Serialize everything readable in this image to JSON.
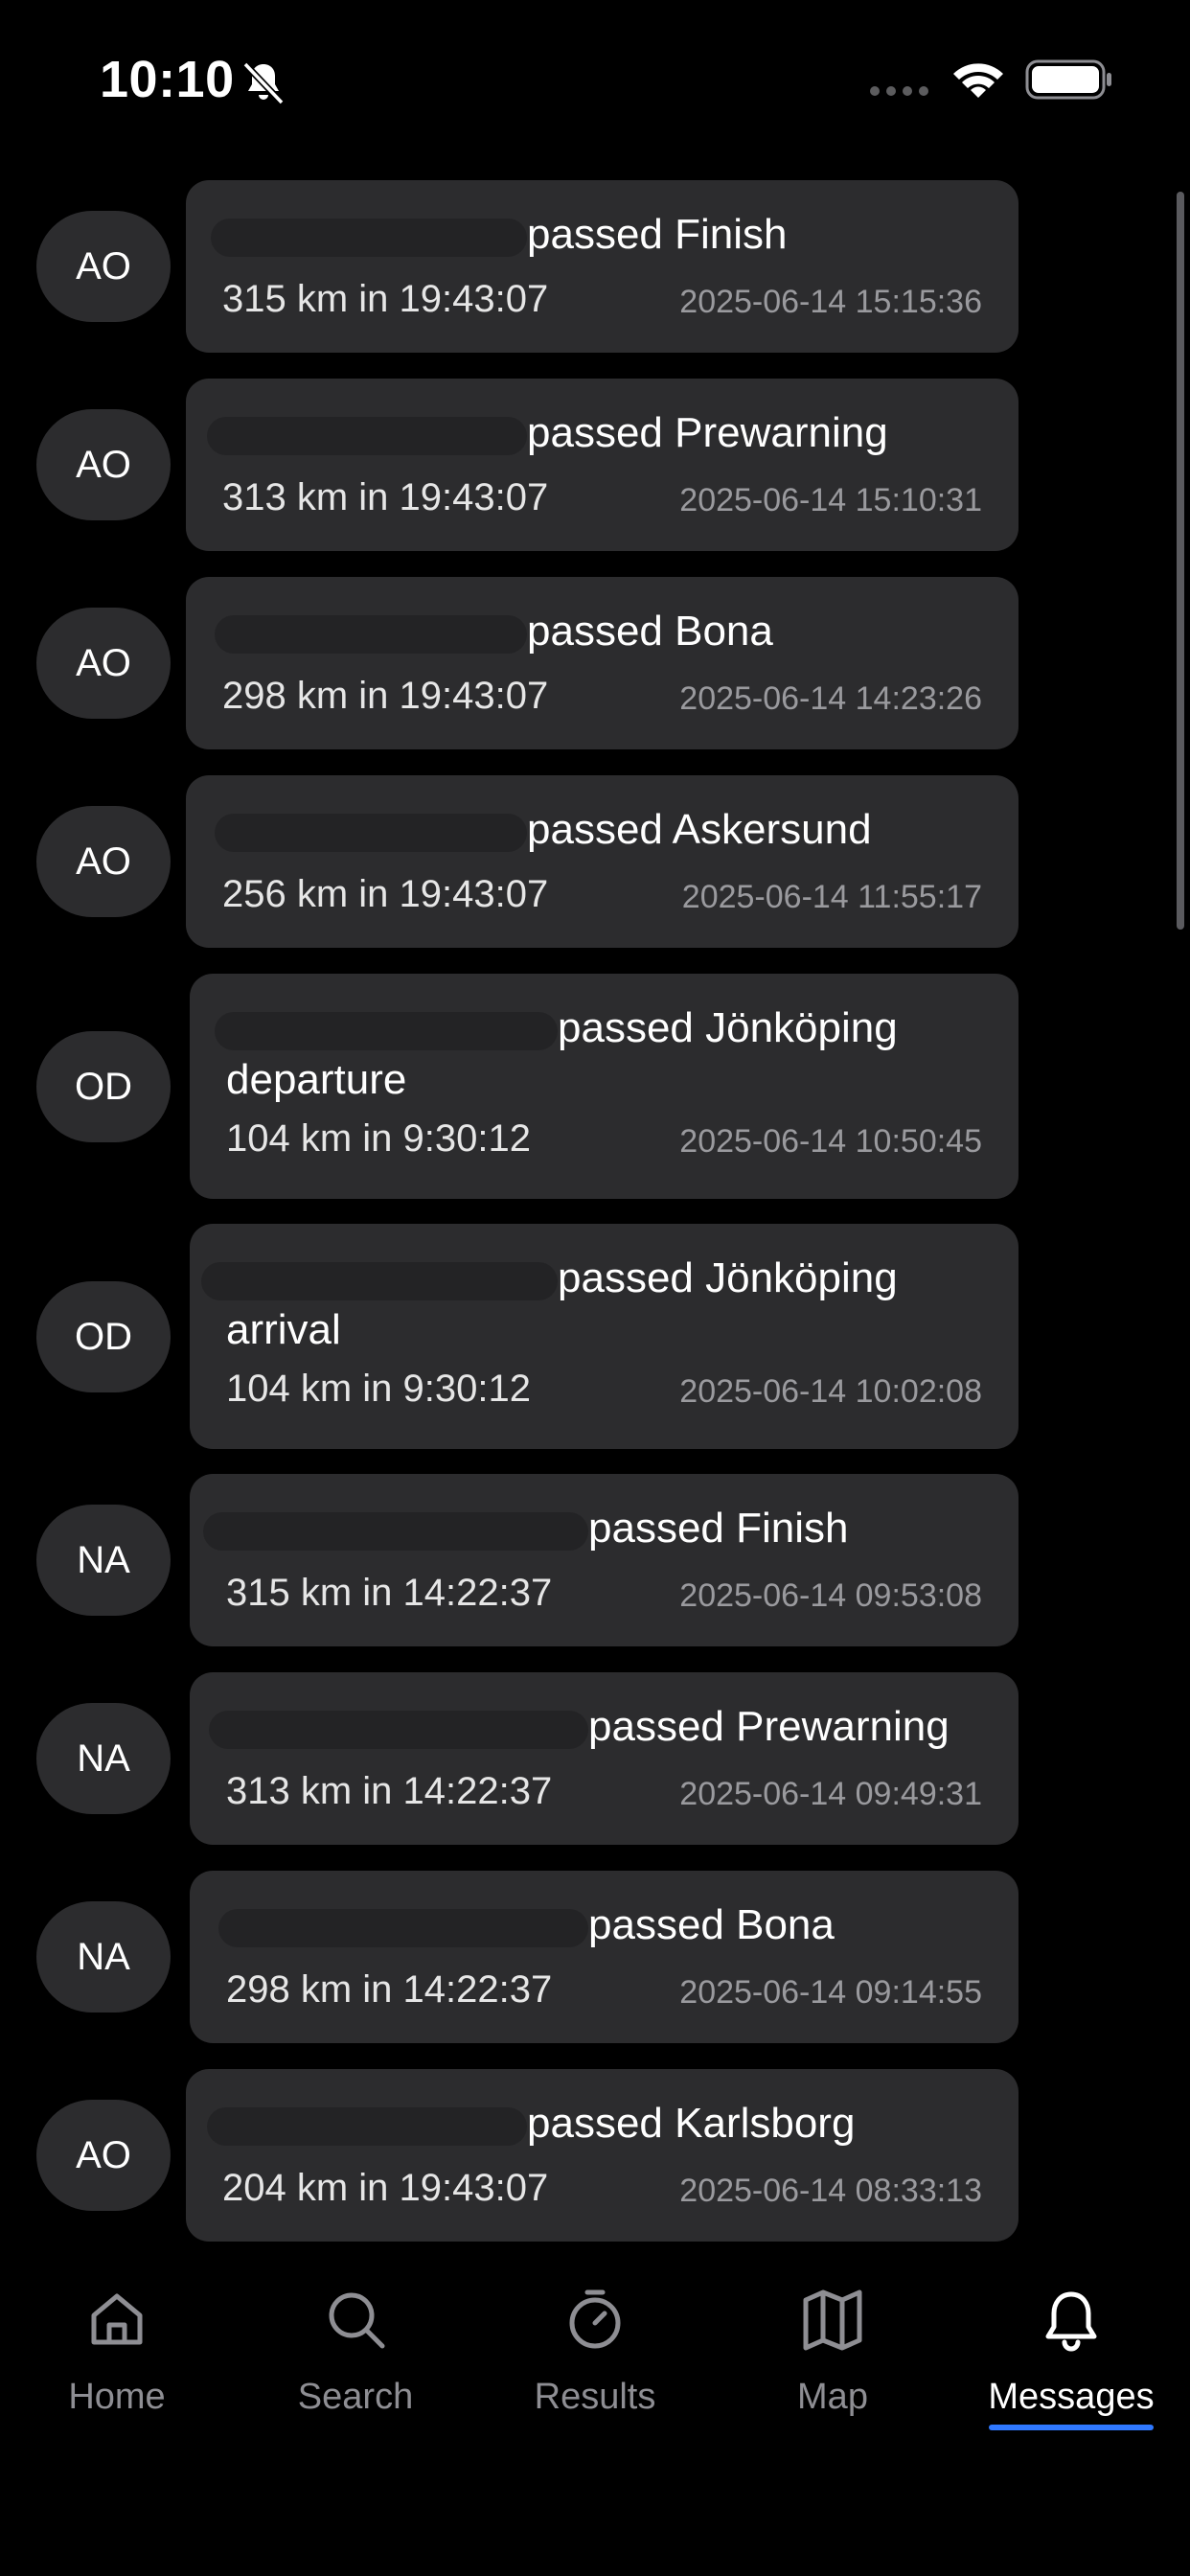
{
  "status_bar": {
    "time": "10:10"
  },
  "messages": [
    {
      "initials": "AO",
      "title": "passed Finish",
      "title_cont": "",
      "stats": "315 km in 19:43:07",
      "timestamp": "2025-06-14 15:15:36"
    },
    {
      "initials": "AO",
      "title": "passed Prewarning",
      "title_cont": "",
      "stats": "313 km in 19:43:07",
      "timestamp": "2025-06-14 15:10:31"
    },
    {
      "initials": "AO",
      "title": "passed Bona",
      "title_cont": "",
      "stats": "298 km in 19:43:07",
      "timestamp": "2025-06-14 14:23:26"
    },
    {
      "initials": "AO",
      "title": "passed Askersund",
      "title_cont": "",
      "stats": "256 km in 19:43:07",
      "timestamp": "2025-06-14 11:55:17"
    },
    {
      "initials": "OD",
      "title": "passed Jönköping",
      "title_cont": "departure",
      "stats": "104 km in 9:30:12",
      "timestamp": "2025-06-14 10:50:45"
    },
    {
      "initials": "OD",
      "title": "passed Jönköping",
      "title_cont": "arrival",
      "stats": "104 km in 9:30:12",
      "timestamp": "2025-06-14 10:02:08"
    },
    {
      "initials": "NA",
      "title": "passed Finish",
      "title_cont": "",
      "stats": "315 km in 14:22:37",
      "timestamp": "2025-06-14 09:53:08"
    },
    {
      "initials": "NA",
      "title": "passed Prewarning",
      "title_cont": "",
      "stats": "313 km in 14:22:37",
      "timestamp": "2025-06-14 09:49:31"
    },
    {
      "initials": "NA",
      "title": "passed Bona",
      "title_cont": "",
      "stats": "298 km in 14:22:37",
      "timestamp": "2025-06-14 09:14:55"
    },
    {
      "initials": "AO",
      "title": "passed Karlsborg",
      "title_cont": "",
      "stats": "204 km in 19:43:07",
      "timestamp": "2025-06-14 08:33:13"
    }
  ],
  "tab_bar": {
    "active": "messages",
    "tabs": [
      {
        "id": "home",
        "label": "Home",
        "icon": "home-icon"
      },
      {
        "id": "search",
        "label": "Search",
        "icon": "search-icon"
      },
      {
        "id": "results",
        "label": "Results",
        "icon": "stopwatch-icon"
      },
      {
        "id": "map",
        "label": "Map",
        "icon": "map-icon"
      },
      {
        "id": "messages",
        "label": "Messages",
        "icon": "bell-icon"
      }
    ]
  },
  "colors": {
    "background": "#000000",
    "bubble": "#2c2c2e",
    "text_primary": "#ffffff",
    "text_secondary": "#9a9a9e",
    "tab_inactive": "#8e8e93",
    "accent": "#2f78ff"
  }
}
